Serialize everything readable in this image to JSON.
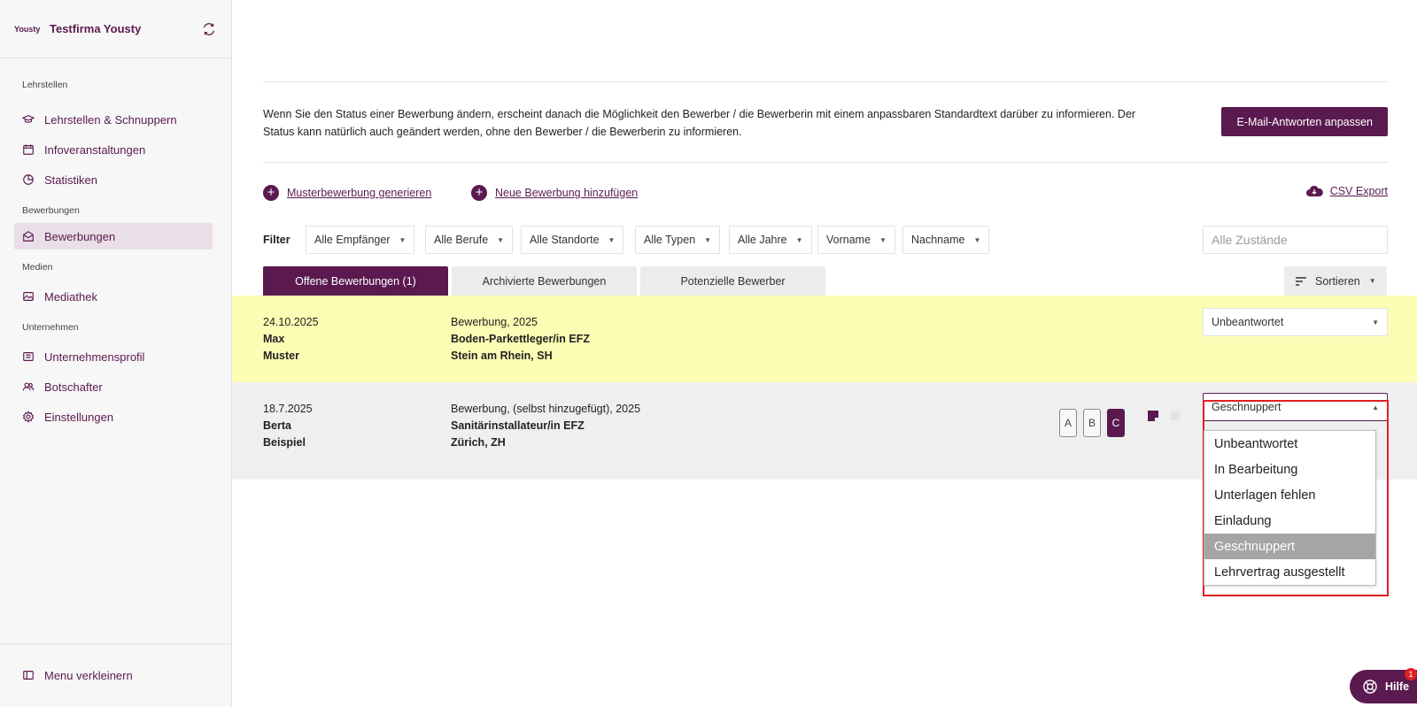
{
  "brand": {
    "logo_text": "Yousty",
    "company": "Testfirma Yousty"
  },
  "sidebar": {
    "sections": [
      {
        "title": "Lehrstellen",
        "items": [
          {
            "label": "Lehrstellen & Schnuppern",
            "icon": "graduation-cap-icon"
          },
          {
            "label": "Infoveranstaltungen",
            "icon": "calendar-icon"
          },
          {
            "label": "Statistiken",
            "icon": "pie-chart-icon"
          }
        ]
      },
      {
        "title": "Bewerbungen",
        "items": [
          {
            "label": "Bewerbungen",
            "icon": "envelope-icon",
            "active": true
          }
        ]
      },
      {
        "title": "Medien",
        "items": [
          {
            "label": "Mediathek",
            "icon": "image-icon"
          }
        ]
      },
      {
        "title": "Unternehmen",
        "items": [
          {
            "label": "Unternehmensprofil",
            "icon": "profile-icon"
          },
          {
            "label": "Botschafter",
            "icon": "users-icon"
          },
          {
            "label": "Einstellungen",
            "icon": "gear-icon"
          }
        ]
      }
    ],
    "collapse_label": "Menu verkleinern"
  },
  "info": {
    "text": "Wenn Sie den Status einer Bewerbung ändern, erscheint danach die Möglichkeit den Bewerber / die Bewerberin mit einem anpassbaren Standardtext darüber zu informieren. Der Status kann natürlich auch geändert werden, ohne den Bewerber / die Bewerberin zu informieren.",
    "button": "E-Mail-Antworten anpassen"
  },
  "actions": {
    "generate": "Musterbewerbung generieren",
    "add": "Neue Bewerbung hinzufügen",
    "export": "CSV Export"
  },
  "filters": {
    "label": "Filter",
    "selects": [
      "Alle Empfänger",
      "Alle Berufe",
      "Alle Standorte",
      "Alle Typen",
      "Alle Jahre",
      "Vorname",
      "Nachname"
    ],
    "status_placeholder": "Alle Zustände"
  },
  "tabs": [
    "Offene Bewerbungen (1)",
    "Archivierte Bewerbungen",
    "Potenzielle Bewerber"
  ],
  "sort_label": "Sortieren",
  "rows": [
    {
      "date": "24.10.2025",
      "first": "Max",
      "last": "Muster",
      "type": "Bewerbung, 2025",
      "job": "Boden-Parkettleger/in EFZ",
      "location": "Stein am Rhein, SH",
      "status": "Unbeantwortet"
    },
    {
      "date": "18.7.2025",
      "first": "Berta",
      "last": "Beispiel",
      "type": "Bewerbung, (selbst hinzugefügt), 2025",
      "job": "Sanitärinstallateur/in EFZ",
      "location": "Zürich, ZH",
      "status": "Geschnuppert",
      "ratings": [
        "A",
        "B",
        "C"
      ],
      "rating_selected": "C"
    }
  ],
  "status_options": [
    "Unbeantwortet",
    "In Bearbeitung",
    "Unterlagen fehlen",
    "Einladung",
    "Geschnuppert",
    "Lehrvertrag ausgestellt"
  ],
  "status_selected": "Geschnuppert",
  "help": {
    "label": "Hilfe",
    "badge": "1"
  },
  "colors": {
    "brand": "#5a1a4f",
    "highlight_row": "#fdfcb4",
    "active_nav": "#eadfe8"
  }
}
